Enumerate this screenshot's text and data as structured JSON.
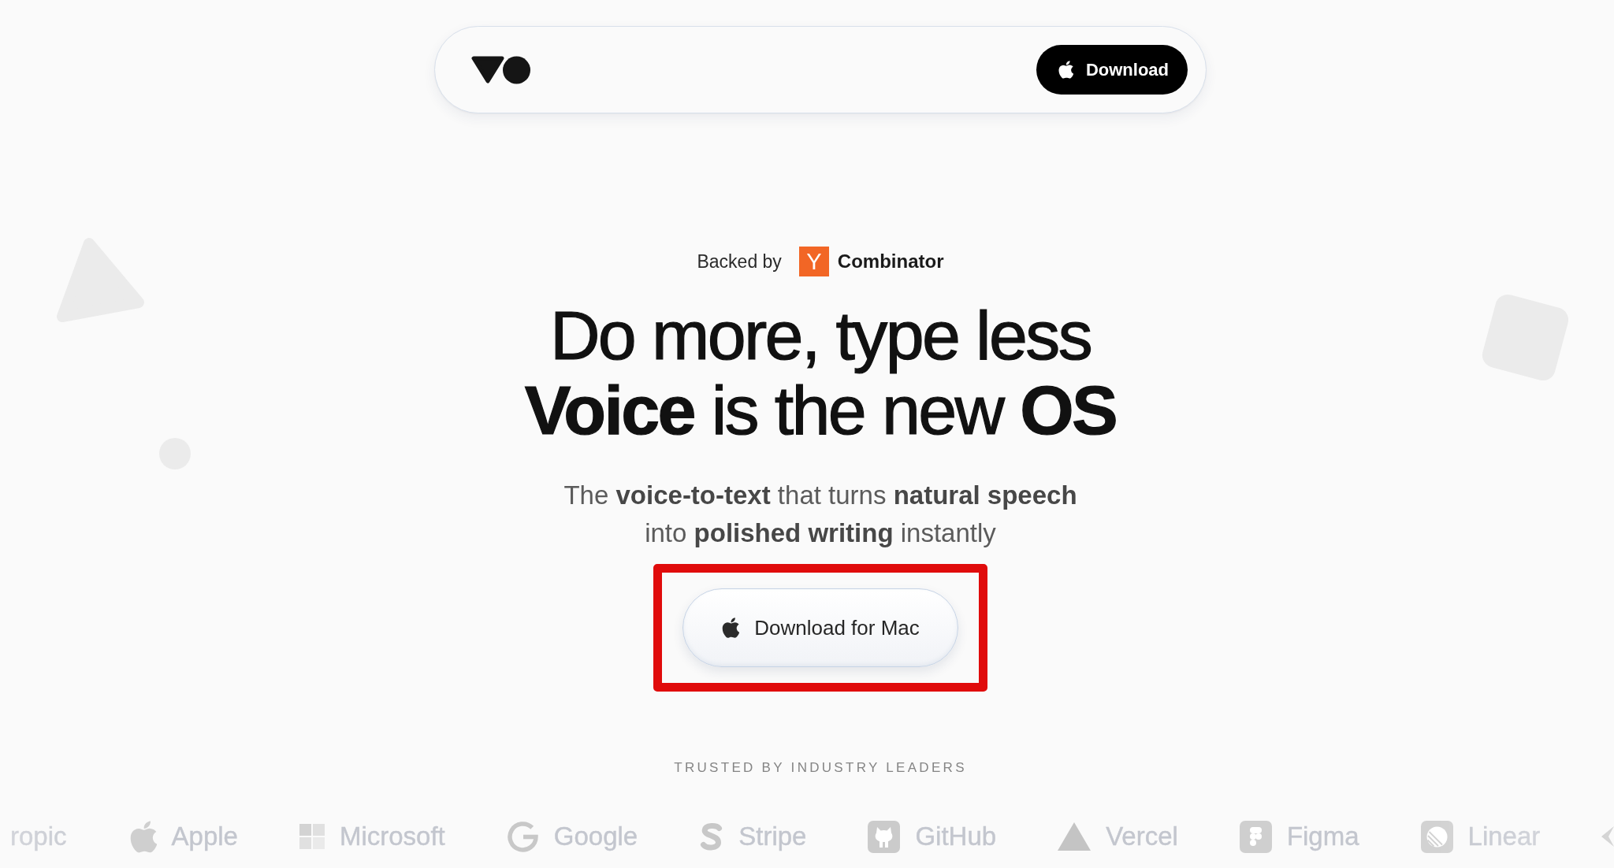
{
  "nav": {
    "download_button": {
      "label": "Download"
    }
  },
  "backed_by": {
    "label": "Backed by",
    "logo_letter": "Y",
    "name": "Combinator"
  },
  "headline": [
    "Do more, type less",
    "**Voice** is the new **OS**"
  ],
  "subtitle": "The **voice-to-text** that turns **natural speech** into **polished writing** instantly",
  "cta": {
    "label": "Download for Mac",
    "highlighted": true
  },
  "trusted": {
    "label": "TRUSTED BY INDUSTRY LEADERS",
    "logos": [
      {
        "name": "ropic"
      },
      {
        "name": "Apple"
      },
      {
        "name": "Microsoft"
      },
      {
        "name": "Google"
      },
      {
        "name": "Stripe"
      },
      {
        "name": "GitHub"
      },
      {
        "name": "Vercel"
      },
      {
        "name": "Figma"
      },
      {
        "name": "Linear"
      }
    ]
  }
}
